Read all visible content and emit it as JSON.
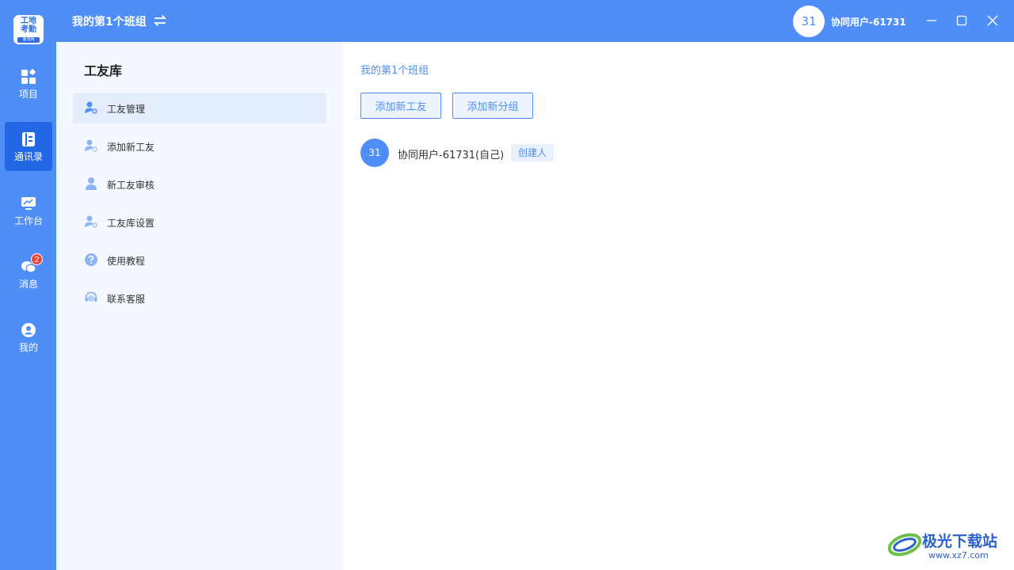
{
  "header": {
    "team_title": "我的第1个班组",
    "user_avatar": "31",
    "user_name": "协同用户-61731",
    "swap_icon": "swap-arrows-icon"
  },
  "app_logo": {
    "line1": "工地",
    "line2": "考勤",
    "sub": "鱼泡网"
  },
  "nav": {
    "items": [
      {
        "label": "项目",
        "icon": "grid-icon"
      },
      {
        "label": "通讯录",
        "icon": "contacts-icon"
      },
      {
        "label": "工作台",
        "icon": "workbench-icon"
      },
      {
        "label": "消息",
        "icon": "message-icon",
        "badge": "2"
      },
      {
        "label": "我的",
        "icon": "profile-icon"
      }
    ],
    "active": "通讯录"
  },
  "sidebar": {
    "title": "工友库",
    "items": [
      {
        "label": "工友管理",
        "icon": "worker-manage-icon"
      },
      {
        "label": "添加新工友",
        "icon": "add-worker-icon"
      },
      {
        "label": "新工友审核",
        "icon": "review-icon"
      },
      {
        "label": "工友库设置",
        "icon": "settings-icon"
      },
      {
        "label": "使用教程",
        "icon": "help-icon"
      },
      {
        "label": "联系客服",
        "icon": "headset-icon"
      }
    ],
    "active": "工友管理"
  },
  "main": {
    "breadcrumb": "我的第1个班组",
    "add_worker_button": "添加新工友",
    "add_group_button": "添加新分组",
    "members": [
      {
        "avatar": "31",
        "name": "协同用户-61731(自己)",
        "tag": "创建人"
      }
    ]
  },
  "watermark": {
    "text": "极光下载站",
    "url": "www.xz7.com"
  },
  "colors": {
    "primary": "#4f8ef7",
    "nav_active": "#2467e6",
    "sidebar_bg": "#f4f8ff",
    "badge": "#f5443b"
  }
}
